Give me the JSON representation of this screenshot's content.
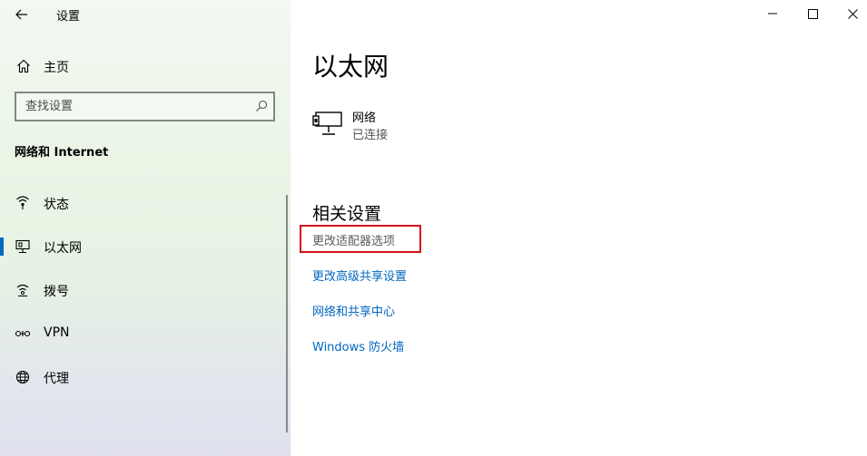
{
  "window": {
    "title": "设置"
  },
  "sidebar": {
    "home_label": "主页",
    "search_placeholder": "查找设置",
    "section_title": "网络和 Internet",
    "items": [
      {
        "label": "状态",
        "icon": "status-icon",
        "active": false
      },
      {
        "label": "以太网",
        "icon": "ethernet-icon",
        "active": true
      },
      {
        "label": "拨号",
        "icon": "dialup-icon",
        "active": false
      },
      {
        "label": "VPN",
        "icon": "vpn-icon",
        "active": false
      },
      {
        "label": "代理",
        "icon": "proxy-globe-icon",
        "active": false
      }
    ]
  },
  "main": {
    "title": "以太网",
    "network": {
      "name": "网络",
      "status": "已连接",
      "icon": "ethernet-network-icon"
    },
    "related_title": "相关设置",
    "links": [
      {
        "label": "更改适配器选项",
        "highlighted": true
      },
      {
        "label": "更改高级共享设置",
        "highlighted": false
      },
      {
        "label": "网络和共享中心",
        "highlighted": false
      },
      {
        "label": "Windows 防火墙",
        "highlighted": false
      }
    ]
  },
  "colors": {
    "accent": "#0067c0",
    "highlight_border": "#d6111c",
    "sidebar_bg": "#eaf5e6"
  }
}
